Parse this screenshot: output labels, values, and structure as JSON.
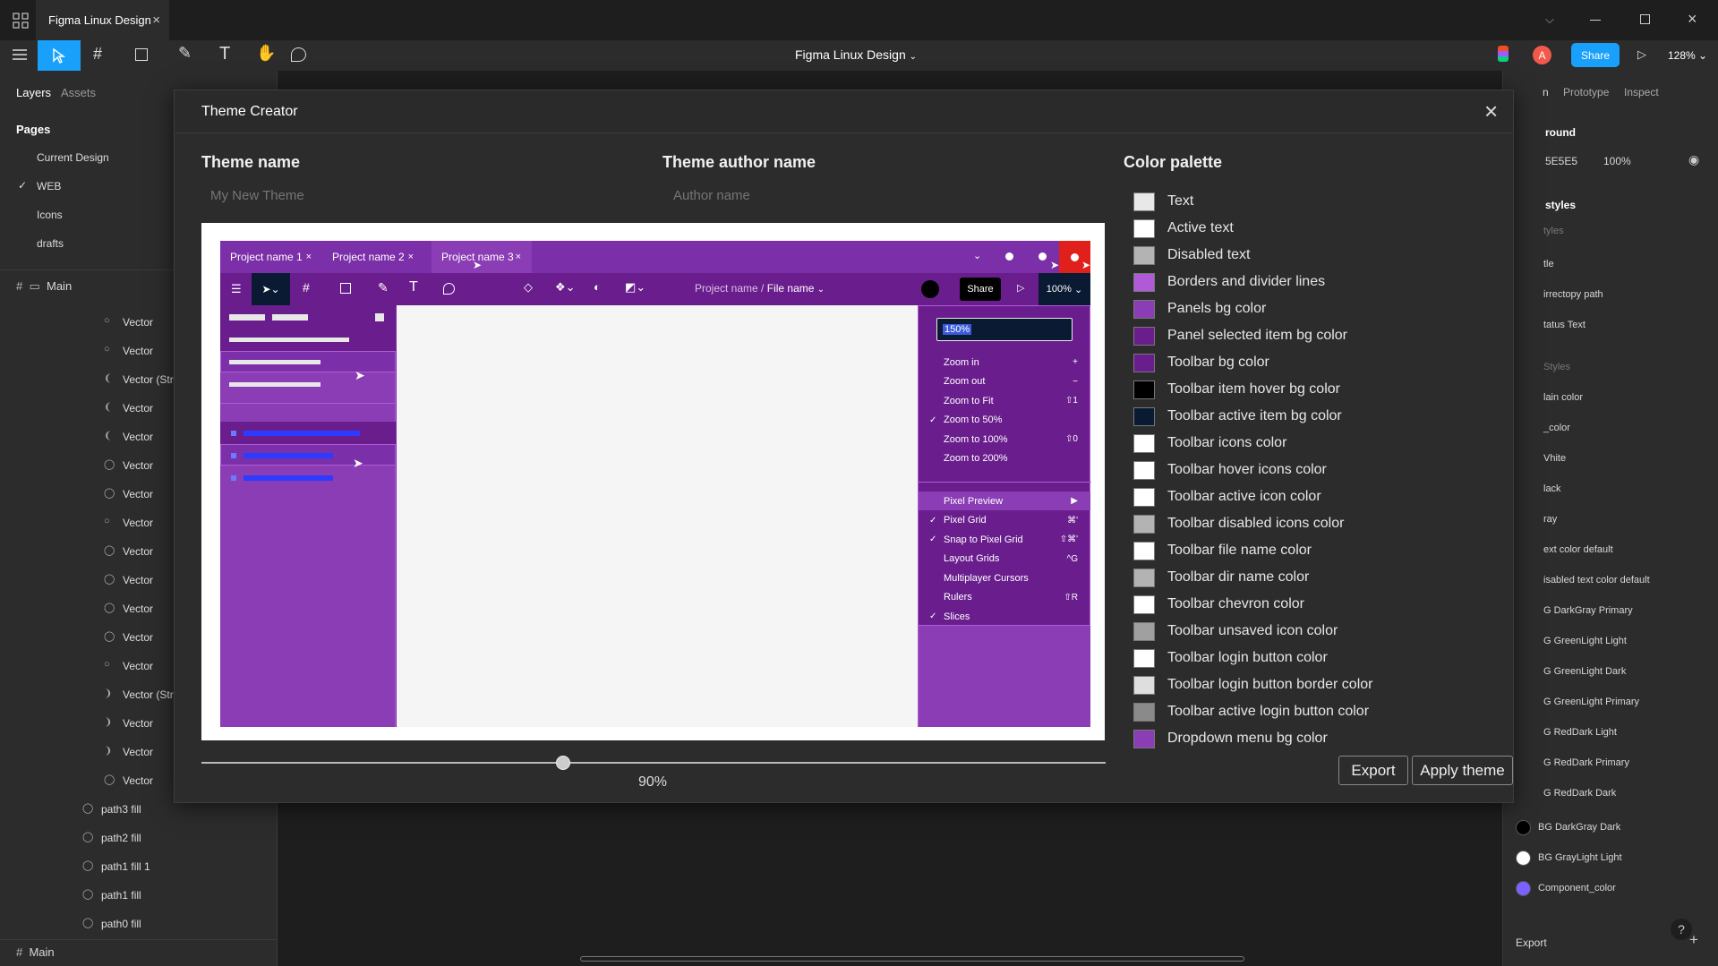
{
  "window": {
    "tab_title": "Figma Linux Design",
    "file_title": "Figma Linux Design",
    "share_label": "Share",
    "zoom": "128%",
    "avatar_letter": "A"
  },
  "left_panel": {
    "tab_layers": "Layers",
    "tab_assets": "Assets",
    "pages_header": "Pages",
    "pages": [
      "Current Design",
      "WEB",
      "Icons",
      "drafts"
    ],
    "frame_label": "Main",
    "layers": [
      "Vector",
      "Vector",
      "Vector (Str",
      "Vector",
      "Vector",
      "Vector",
      "Vector",
      "Vector",
      "Vector",
      "Vector",
      "Vector",
      "Vector",
      "Vector",
      "Vector (Str",
      "Vector",
      "Vector",
      "Vector"
    ],
    "fills": [
      "path3 fill",
      "path2 fill",
      "path1 fill 1",
      "path1 fill",
      "path0 fill"
    ],
    "bottom_frame": "Main"
  },
  "right_panel": {
    "tab_prototype": "Prototype",
    "tab_inspect": "Inspect",
    "partial_tab": "n",
    "background_header": "round",
    "bg_hex": "5E5E5",
    "bg_opacity": "100%",
    "styles_header": "styles",
    "items": [
      "tyles",
      "tle",
      "irrectopy path",
      "tatus Text",
      "Styles",
      "lain color",
      "_color",
      "Vhite",
      "lack",
      "ray",
      "ext color default",
      "isabled text color default",
      "G DarkGray Primary",
      "G GreenLight Light",
      "G GreenLight Dark",
      "G GreenLight Primary",
      "G RedDark Light",
      "G RedDark Primary",
      "G RedDark Dark"
    ],
    "color_items": [
      {
        "label": "BG DarkGray Dark",
        "color": "#000000"
      },
      {
        "label": "BG GrayLight Light",
        "color": "#ffffff"
      },
      {
        "label": "Component_color",
        "color": "#7b61ff"
      }
    ],
    "export_label": "Export",
    "help": "?"
  },
  "modal": {
    "title": "Theme Creator",
    "theme_name_label": "Theme name",
    "theme_name_placeholder": "My New Theme",
    "author_label": "Theme author name",
    "author_placeholder": "Author name",
    "palette_label": "Color palette",
    "palette": [
      {
        "label": "Text",
        "color": "#e8e8e8"
      },
      {
        "label": "Active text",
        "color": "#ffffff"
      },
      {
        "label": "Disabled text",
        "color": "#b3b3b3"
      },
      {
        "label": "Borders and divider lines",
        "color": "#b05ad8"
      },
      {
        "label": "Panels bg color",
        "color": "#8b3db5"
      },
      {
        "label": "Panel selected item bg color",
        "color": "#6a1e8e"
      },
      {
        "label": "Toolbar bg color",
        "color": "#6a1e8e"
      },
      {
        "label": "Toolbar item hover bg color",
        "color": "#000000"
      },
      {
        "label": "Toolbar active item bg color",
        "color": "#0b1a33"
      },
      {
        "label": "Toolbar icons color",
        "color": "#ffffff"
      },
      {
        "label": "Toolbar hover icons color",
        "color": "#ffffff"
      },
      {
        "label": "Toolbar active icon color",
        "color": "#ffffff"
      },
      {
        "label": "Toolbar disabled icons color",
        "color": "#b3b3b3"
      },
      {
        "label": "Toolbar file name color",
        "color": "#ffffff"
      },
      {
        "label": "Toolbar dir name color",
        "color": "#b3b3b3"
      },
      {
        "label": "Toolbar chevron color",
        "color": "#ffffff"
      },
      {
        "label": "Toolbar unsaved icon color",
        "color": "#a0a0a0"
      },
      {
        "label": "Toolbar login button color",
        "color": "#ffffff"
      },
      {
        "label": "Toolbar login button border color",
        "color": "#dedede"
      },
      {
        "label": "Toolbar active login button color",
        "color": "#8a8a8a"
      },
      {
        "label": "Dropdown menu bg color",
        "color": "#8b3db5"
      }
    ],
    "scale_value": 0.4,
    "scale_label": "90%",
    "export_button": "Export",
    "apply_button": "Apply theme"
  },
  "preview": {
    "tabs": [
      "Project name 1",
      "Project name 2",
      "Project name 3"
    ],
    "breadcrumb_project": "Project name",
    "breadcrumb_sep": "/",
    "breadcrumb_file": "File name",
    "share_label": "Share",
    "zoom_label": "100%",
    "zoom_input": "150%",
    "menu": [
      {
        "label": "Zoom in",
        "shortcut": "+",
        "checked": false
      },
      {
        "label": "Zoom out",
        "shortcut": "−",
        "checked": false
      },
      {
        "label": "Zoom to Fit",
        "shortcut": "⇧1",
        "checked": false
      },
      {
        "label": "Zoom to 50%",
        "shortcut": "",
        "checked": true
      },
      {
        "label": "Zoom to 100%",
        "shortcut": "⇧0",
        "checked": false
      },
      {
        "label": "Zoom to 200%",
        "shortcut": "",
        "checked": false
      }
    ],
    "menu2": [
      {
        "label": "Pixel Preview",
        "shortcut": "▶",
        "checked": false,
        "active": true
      },
      {
        "label": "Pixel Grid",
        "shortcut": "⌘'",
        "checked": true
      },
      {
        "label": "Snap to Pixel Grid",
        "shortcut": "⇧⌘'",
        "checked": true
      },
      {
        "label": "Layout Grids",
        "shortcut": "^G",
        "checked": false
      },
      {
        "label": "Multiplayer Cursors",
        "shortcut": "",
        "checked": false
      },
      {
        "label": "Rulers",
        "shortcut": "⇧R",
        "checked": false
      },
      {
        "label": "Slices",
        "shortcut": "",
        "checked": true
      }
    ],
    "colors": {
      "app_bg": "#7b2fa8",
      "toolbar_bg": "#6a1e8e",
      "canvas_bg": "#f5f5f5",
      "accent_red": "#e0201b",
      "blue": "#2b3bff"
    }
  },
  "accent": "#18a0fb"
}
